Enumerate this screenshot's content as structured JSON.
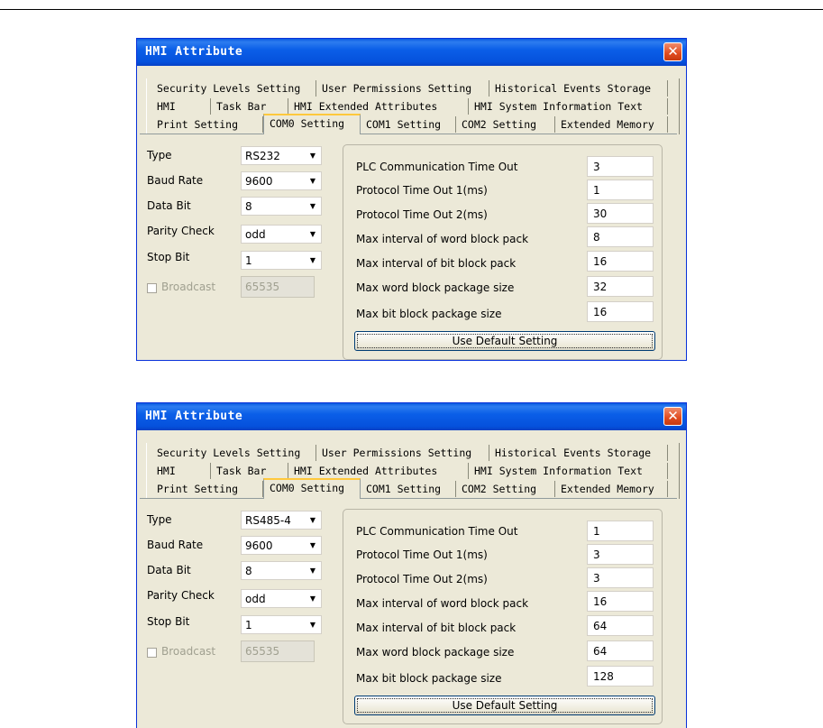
{
  "dialogs": [
    {
      "title": "HMI Attribute",
      "close_glyph": "✕",
      "tabs": {
        "row1": [
          "Security Levels Setting",
          "User Permissions Setting",
          "Historical Events Storage"
        ],
        "row2": [
          "HMI",
          "Task Bar",
          "HMI Extended Attributes",
          "HMI System Information Text"
        ],
        "row3": [
          "Print Setting",
          "COM0 Setting",
          "COM1 Setting",
          "COM2 Setting",
          "Extended Memory"
        ],
        "active": "COM0 Setting"
      },
      "fields": {
        "type": {
          "label": "Type",
          "value": "RS232"
        },
        "baud_rate": {
          "label": "Baud Rate",
          "value": "9600"
        },
        "data_bit": {
          "label": "Data Bit",
          "value": "8"
        },
        "parity_check": {
          "label": "Parity Check",
          "value": "odd"
        },
        "stop_bit": {
          "label": "Stop Bit",
          "value": "1"
        },
        "broadcast": {
          "label": "Broadcast",
          "value": "65535",
          "checked": false,
          "enabled": false
        }
      },
      "params": [
        {
          "label": "PLC Communication Time Out",
          "value": "3"
        },
        {
          "label": "Protocol Time Out 1(ms)",
          "value": "1"
        },
        {
          "label": "Protocol Time Out 2(ms)",
          "value": "30"
        },
        {
          "label": "Max interval of word block pack",
          "value": "8"
        },
        {
          "label": "Max interval of bit block pack",
          "value": "16"
        },
        {
          "label": "Max word block package size",
          "value": "32"
        },
        {
          "label": "Max bit block package size",
          "value": "16"
        }
      ],
      "default_button": "Use Default Setting"
    },
    {
      "title": "HMI Attribute",
      "close_glyph": "✕",
      "tabs": {
        "row1": [
          "Security Levels Setting",
          "User Permissions Setting",
          "Historical Events Storage"
        ],
        "row2": [
          "HMI",
          "Task Bar",
          "HMI Extended Attributes",
          "HMI System Information Text"
        ],
        "row3": [
          "Print Setting",
          "COM0 Setting",
          "COM1 Setting",
          "COM2 Setting",
          "Extended Memory"
        ],
        "active": "COM0 Setting"
      },
      "fields": {
        "type": {
          "label": "Type",
          "value": "RS485-4"
        },
        "baud_rate": {
          "label": "Baud Rate",
          "value": "9600"
        },
        "data_bit": {
          "label": "Data Bit",
          "value": "8"
        },
        "parity_check": {
          "label": "Parity Check",
          "value": "odd"
        },
        "stop_bit": {
          "label": "Stop Bit",
          "value": "1"
        },
        "broadcast": {
          "label": "Broadcast",
          "value": "65535",
          "checked": false,
          "enabled": false
        }
      },
      "params": [
        {
          "label": "PLC Communication Time Out",
          "value": "1"
        },
        {
          "label": "Protocol Time Out 1(ms)",
          "value": "3"
        },
        {
          "label": "Protocol Time Out 2(ms)",
          "value": "3"
        },
        {
          "label": "Max interval of word block pack",
          "value": "16"
        },
        {
          "label": "Max interval of bit block pack",
          "value": "64"
        },
        {
          "label": "Max word block package size",
          "value": "64"
        },
        {
          "label": "Max bit block package size",
          "value": "128"
        }
      ],
      "default_button": "Use Default Setting"
    }
  ],
  "colors": {
    "titlebar": "#0b5fe8",
    "dialog_face": "#ece9d8",
    "close_button": "#e04a1e",
    "active_tab_highlight": "#ffc83c"
  }
}
